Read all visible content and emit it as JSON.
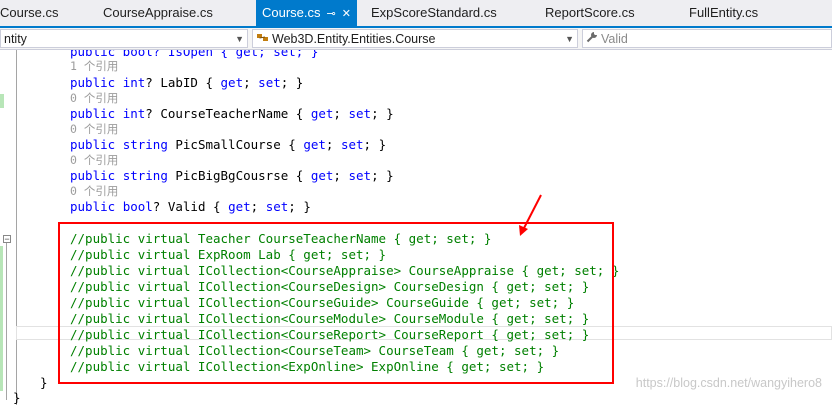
{
  "tabs": [
    {
      "label": "Course.cs",
      "active": false
    },
    {
      "label": "CourseAppraise.cs",
      "active": false
    },
    {
      "label": "Course.cs",
      "active": true
    },
    {
      "label": "ExpScoreStandard.cs",
      "active": false
    },
    {
      "label": "ReportScore.cs",
      "active": false
    },
    {
      "label": "FullEntity.cs",
      "active": false
    }
  ],
  "nav": {
    "project": "ntity",
    "type": "Web3D.Entity.Entities.Course",
    "member": "Valid"
  },
  "code": {
    "partial_top": "public bool? IsOpen { get; set; }",
    "lines": [
      {
        "refs": "1 个引用",
        "code": "public int? LabID { get; set; }"
      },
      {
        "refs": "0 个引用",
        "code": "public int? CourseTeacherName { get; set; }"
      },
      {
        "refs": "0 个引用",
        "code": "public string PicSmallCourse { get; set; }"
      },
      {
        "refs": "0 个引用",
        "code": "public string PicBigBgCousrse { get; set; }"
      },
      {
        "refs": "0 个引用",
        "code": "public bool? Valid { get; set; }"
      }
    ],
    "comments": [
      "//public virtual Teacher CourseTeacherName { get; set; }",
      "//public virtual ExpRoom Lab { get; set; }",
      "//public virtual ICollection<CourseAppraise> CourseAppraise { get; set; }",
      "//public virtual ICollection<CourseDesign> CourseDesign { get; set; }",
      "//public virtual ICollection<CourseGuide> CourseGuide { get; set; }",
      "//public virtual ICollection<CourseModule> CourseModule { get; set; }",
      "//public virtual ICollection<CourseReport> CourseReport { get; set; }",
      "//public virtual ICollection<CourseTeam> CourseTeam { get; set; }",
      "//public virtual ICollection<ExpOnline> ExpOnline { get; set; }"
    ],
    "close_brace_inner": "}",
    "close_brace_outer": "}"
  },
  "watermark": "https://blog.csdn.net/wangyihero8",
  "colors": {
    "accent": "#007acc",
    "keyword": "#0000ff",
    "comment": "#008000",
    "highlight": "#ff0000"
  }
}
